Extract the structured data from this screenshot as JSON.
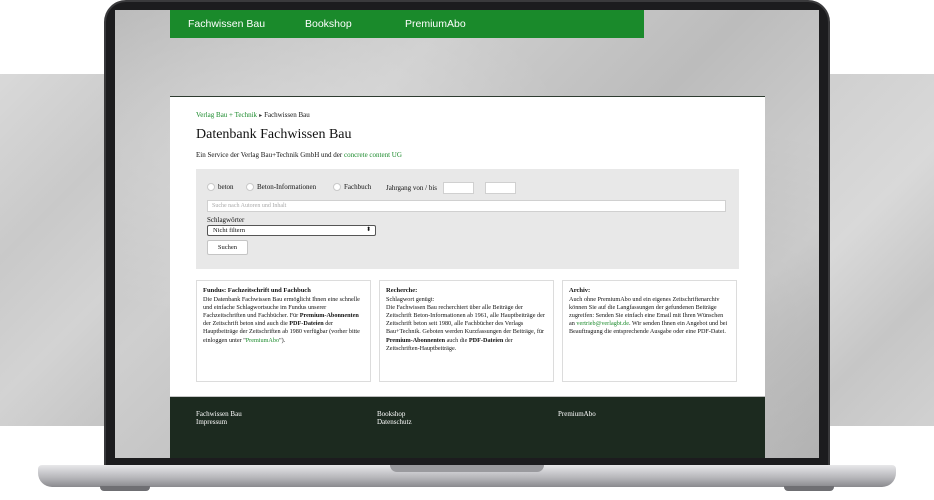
{
  "nav": {
    "items": [
      "Fachwissen Bau",
      "Bookshop",
      "PremiumAbo"
    ]
  },
  "breadcrumb": {
    "parent": "Verlag Bau + Technik",
    "current": "Fachwissen Bau"
  },
  "page": {
    "title": "Datenbank Fachwissen Bau",
    "subtitle_prefix": "Ein Service der Verlag Bau+Technik GmbH und der ",
    "subtitle_link": "concrete content UG"
  },
  "search": {
    "options": [
      "beton",
      "Beton-Informationen",
      "Fachbuch"
    ],
    "year_label": "Jahrgang von / bis",
    "text_placeholder": "Suche nach Autoren und Inhalt",
    "keyword_label": "Schlagwörter",
    "keyword_selected": "Nicht filtern",
    "submit_label": "Suchen"
  },
  "boxes": {
    "fundus": {
      "heading": "Fundus: Fachzeitschrift und Fachbuch",
      "t1": "Die Datenbank Fachwissen Bau ermöglicht Ihnen eine schnelle und einfache Schlagwortsuche im Fundus unserer Fachzeitschriften und Fachbücher. Für ",
      "b1": "Premium-Abonnenten",
      "t2": " der Zeitschrift beton sind auch die ",
      "b2": "PDF-Dateien",
      "t3": " der Hauptbeiträge der Zeitschriften ab 1980 verfügbar (vorher bitte einloggen unter \"",
      "link": "PremiumAbo",
      "t4": "\")."
    },
    "recherche": {
      "heading": "Recherche:",
      "t1": "Schlagwort genügt:",
      "t2": "Die Fachwissen Bau recherchiert über alle Beiträge der Zeitschrift Beton-Informationen ab 1961, alle Hauptbeiträge der Zeitschrift beton seit 1980, alle Fachbücher des Verlags Bau+Technik. Geboten werden Kurzfassungen der Beiträge, für ",
      "b1": "Premium-Abonnenten",
      "t3": " auch die ",
      "b2": "PDF-Dateien",
      "t4": " der Zeitschriften-Hauptbeiträge."
    },
    "archiv": {
      "heading": "Archiv:",
      "t1": "Auch ohne PremiumAbo und ein eigenes Zeitschriftenarchiv können Sie auf die Langfassungen der gefundenen Beiträge zugreifen: Senden Sie einfach eine Email mit Ihren Wünschen an ",
      "link": "vertrieb@verlagbt.de",
      "t2": ". Wir senden Ihnen ein Angebot und bei Beauftragung die entsprechende Ausgabe oder eine PDF-Datei."
    }
  },
  "footer": {
    "col1": [
      "Fachwissen Bau",
      "Impressum"
    ],
    "col2": [
      "Bookshop",
      "Datenschutz"
    ],
    "col3": [
      "PremiumAbo"
    ]
  },
  "colors": {
    "brand_green": "#1a8a2b",
    "footer_dark": "#1c2a1f"
  }
}
